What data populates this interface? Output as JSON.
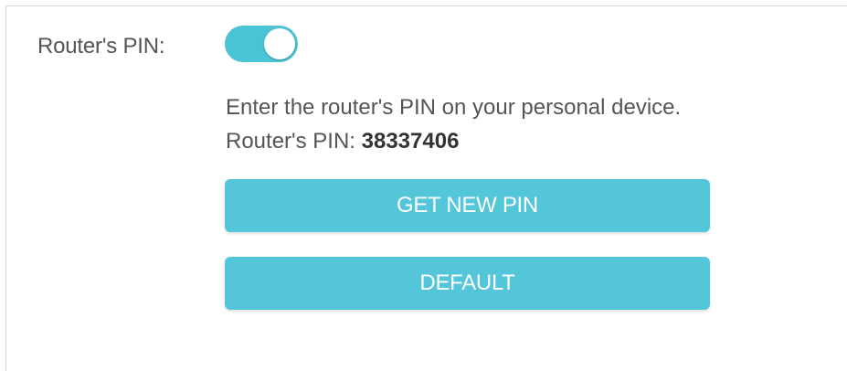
{
  "pin_setting": {
    "label": "Router's PIN:",
    "toggle_on": true
  },
  "instructions": {
    "text": "Enter the router's PIN on your personal device.",
    "pin_prefix": "Router's PIN: ",
    "pin_value": "38337406"
  },
  "buttons": {
    "get_new_pin": "GET NEW PIN",
    "default": "DEFAULT"
  },
  "colors": {
    "accent": "#53c6da",
    "toggle": "#4bc3d6",
    "text": "#555555"
  }
}
